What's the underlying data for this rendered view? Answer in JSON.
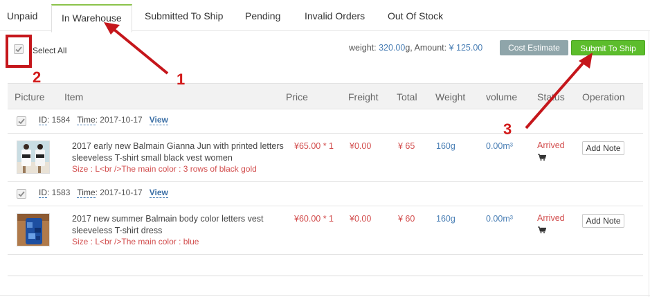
{
  "tabs": [
    {
      "label": "Unpaid"
    },
    {
      "label": "In Warehouse"
    },
    {
      "label": "Submitted To Ship"
    },
    {
      "label": "Pending"
    },
    {
      "label": "Invalid Orders"
    },
    {
      "label": "Out Of Stock"
    }
  ],
  "toolbar": {
    "select_all_label": "Select All",
    "weight_label": "weight:",
    "weight_value": "320.00",
    "weight_unit": "g",
    "amount_label": "Amount:",
    "amount_value": "¥ 125.00",
    "cost_estimate_label": "Cost Estimate",
    "submit_to_ship_label": "Submit To Ship"
  },
  "table": {
    "headers": [
      "Picture",
      "Item",
      "Price",
      "Freight",
      "Total",
      "Weight",
      "volume",
      "Status",
      "Operation"
    ],
    "orders": [
      {
        "id_label": "ID",
        "id": ": 1584",
        "time_label": "Time",
        "time": ": 2017-10-17",
        "view_label": "View",
        "title_line1": "2017 early new Balmain Gianna Jun with printed letters",
        "title_line2": "sleeveless T-shirt small black vest women",
        "spec": "Size : L<br />The main color : 3 rows of black gold",
        "price": "¥65.00 * 1",
        "freight": "¥0.00",
        "total": "¥ 65",
        "weight": "160g",
        "volume": "0.00m³",
        "status": "Arrived",
        "note_label": "Add Note"
      },
      {
        "id_label": "ID",
        "id": ": 1583",
        "time_label": "Time",
        "time": ": 2017-10-17",
        "view_label": "View",
        "title_line1": "2017 new summer Balmain body color letters vest",
        "title_line2": "sleeveless T-shirt dress",
        "spec": "Size : L<br />The main color : blue",
        "price": "¥60.00 * 1",
        "freight": "¥0.00",
        "total": "¥ 60",
        "weight": "160g",
        "volume": "0.00m³",
        "status": "Arrived",
        "note_label": "Add Note"
      }
    ]
  },
  "annotations": {
    "callout_1": "1",
    "callout_2": "2",
    "callout_3": "3"
  },
  "colors": {
    "active_tab_accent": "#8bc34a",
    "submit_button": "#5cbd2c",
    "cost_estimate_button": "#8fa5aa",
    "annotation_red": "#c5161b",
    "price_red": "#d24d4d",
    "weight_blue": "#4a7fb5"
  },
  "icons": {
    "checkbox": "check-icon",
    "status": "cart-icon"
  }
}
